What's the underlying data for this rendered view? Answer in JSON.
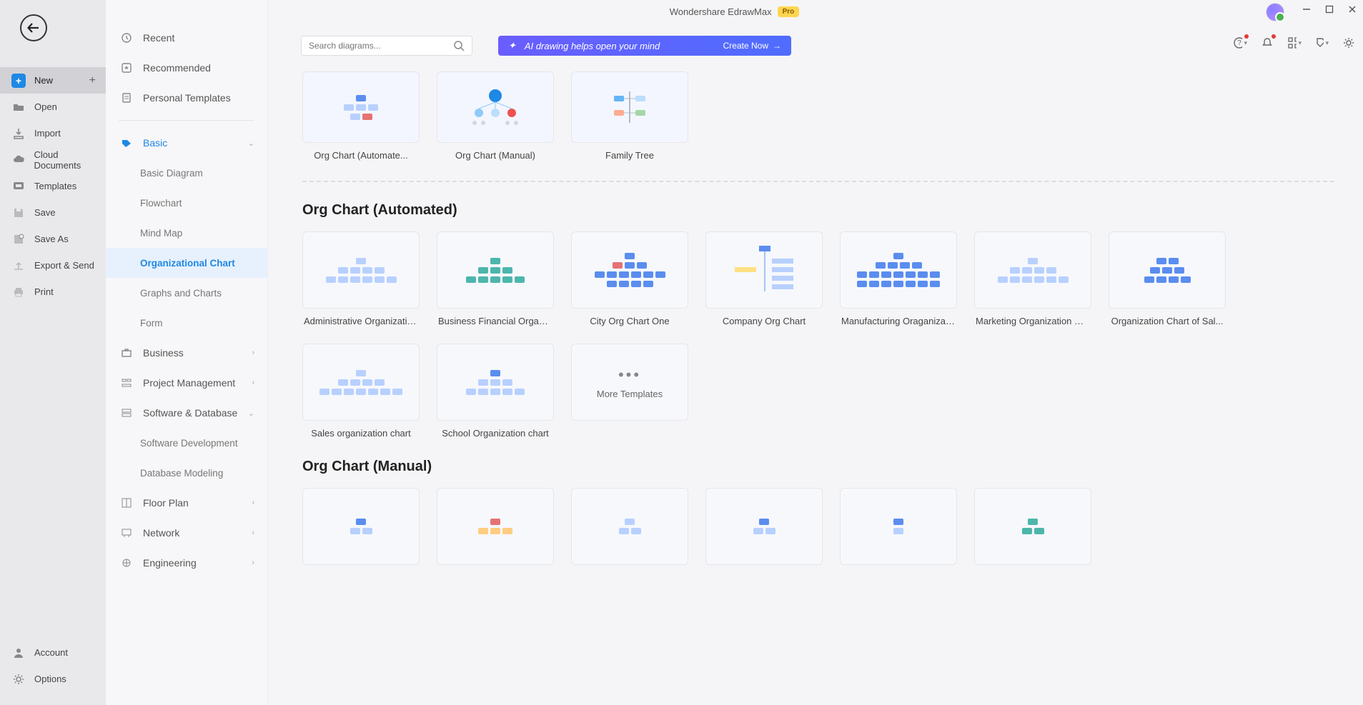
{
  "app": {
    "title": "Wondershare EdrawMax",
    "pro_badge": "Pro"
  },
  "search": {
    "placeholder": "Search diagrams..."
  },
  "ai_banner": {
    "text": "AI drawing helps open your mind",
    "cta": "Create Now"
  },
  "rail": {
    "new": "New",
    "open": "Open",
    "import": "Import",
    "cloud": "Cloud Documents",
    "templates": "Templates",
    "save": "Save",
    "save_as": "Save As",
    "export": "Export & Send",
    "print": "Print",
    "account": "Account",
    "options": "Options"
  },
  "cats": {
    "recent": "Recent",
    "recommended": "Recommended",
    "personal": "Personal Templates",
    "basic": "Basic",
    "basic_sub": {
      "basic_diagram": "Basic Diagram",
      "flowchart": "Flowchart",
      "mind_map": "Mind Map",
      "org_chart": "Organizational Chart",
      "graphs": "Graphs and Charts",
      "form": "Form"
    },
    "business": "Business",
    "pm": "Project Management",
    "software_db": "Software & Database",
    "software_db_sub": {
      "dev": "Software Development",
      "db": "Database Modeling"
    },
    "floor_plan": "Floor Plan",
    "network": "Network",
    "engineering": "Engineering"
  },
  "top_templates": [
    {
      "label": "Org Chart (Automate...",
      "thumb": "org1"
    },
    {
      "label": "Org Chart (Manual)",
      "thumb": "org2"
    },
    {
      "label": "Family Tree",
      "thumb": "family"
    }
  ],
  "sections": [
    {
      "title": "Org Chart (Automated)",
      "items": [
        {
          "label": "Administrative Organizatio..."
        },
        {
          "label": "Business Financial Organiz..."
        },
        {
          "label": "City Org Chart One"
        },
        {
          "label": "Company Org Chart"
        },
        {
          "label": "Manufacturing Oraganizati..."
        },
        {
          "label": "Marketing Organization Ch..."
        },
        {
          "label": "Organization Chart of Sal..."
        },
        {
          "label": "Sales organization chart"
        },
        {
          "label": "School Organization chart"
        }
      ],
      "more": "More Templates"
    },
    {
      "title": "Org Chart (Manual)",
      "items": [
        {
          "label": ""
        },
        {
          "label": ""
        },
        {
          "label": ""
        },
        {
          "label": ""
        },
        {
          "label": ""
        },
        {
          "label": ""
        }
      ]
    }
  ]
}
